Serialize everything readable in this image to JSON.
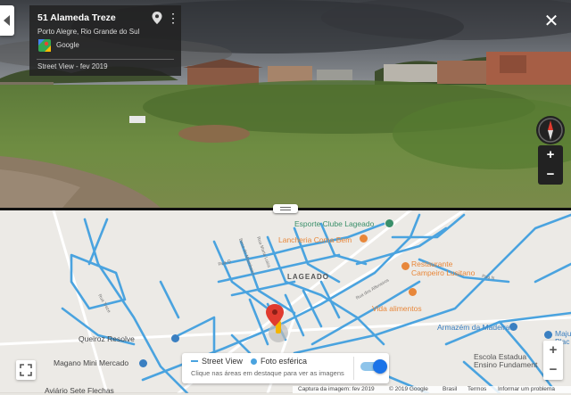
{
  "infocard": {
    "address": "51 Alameda Treze",
    "city": "Porto Alegre, Rio Grande do Sul",
    "provider": "Google",
    "capture": "Street View - fev 2019"
  },
  "controls": {
    "more_glyph": "⋮",
    "close_glyph": "✕",
    "zoom_in": "+",
    "zoom_out": "−"
  },
  "map": {
    "labels": {
      "esporte": "Esporte Clube Lageado",
      "lancheria": "Lancheria Coma Bem",
      "restaurante_1": "Restaurante",
      "restaurante_2": "Campeiro Lusitano",
      "lageado": "LAGEADO",
      "vida": "Vida alimentos",
      "queiroz": "Queiroz Resolve",
      "armazem": "Armazém da Madeira",
      "magano": "Magano Mini Mercado",
      "escola_1": "Escola Estadua",
      "escola_2": "Ensino Fundament",
      "avario": "Aviário Sete Flechas",
      "maju_1": "Maju",
      "maju_2": "Plac"
    },
    "street_labels": [
      "Rua Treze",
      "Beco do Marinheiro",
      "Rua Maria Luiza",
      "Rua dos Alfeneiros",
      "Rua Q",
      "Rua N"
    ]
  },
  "layer_toggle": {
    "street_view": "Street View",
    "photo": "Foto esférica",
    "hint": "Clique nas áreas em destaque para ver as imagens",
    "enabled": true
  },
  "footer": {
    "capture": "Captura da imagem: fev 2019",
    "copyright": "© 2019 Google",
    "country": "Brasil",
    "terms": "Termos",
    "report": "Informar um problema"
  },
  "colors": {
    "route": "#4aa3df",
    "poi_orange": "#e8873a",
    "poi_blue": "#3a7fc1",
    "pin_red": "#e03b2f"
  }
}
